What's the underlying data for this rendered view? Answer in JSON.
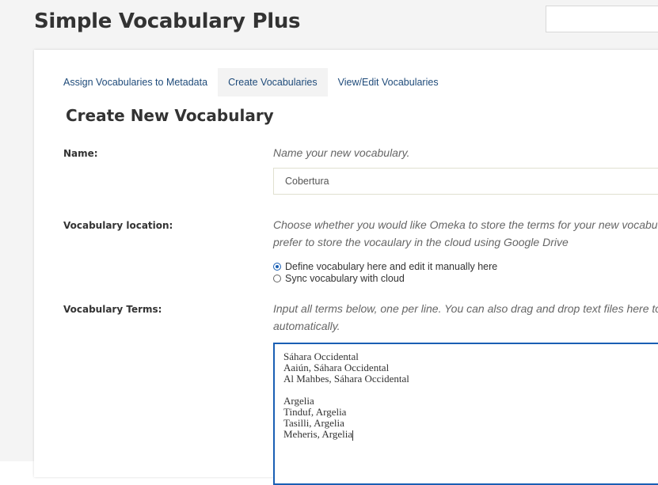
{
  "header": {
    "title": "Simple Vocabulary Plus",
    "search_placeholder": ""
  },
  "tabs": [
    {
      "label": "Assign Vocabularies to Metadata",
      "active": false
    },
    {
      "label": "Create Vocabularies",
      "active": true
    },
    {
      "label": "View/Edit Vocabularies",
      "active": false
    }
  ],
  "form": {
    "section_title": "Create New Vocabulary",
    "name": {
      "label": "Name:",
      "hint": "Name your new vocabulary.",
      "value": "Cobertura"
    },
    "location": {
      "label": "Vocabulary location:",
      "hint_line1": "Choose whether you would like Omeka to store the terms for your new vocabula",
      "hint_line2": "prefer to store the vocaulary in the cloud using Google Drive",
      "options": [
        {
          "label": "Define vocabulary here and edit it manually here",
          "checked": true
        },
        {
          "label": "Sync vocabulary with cloud",
          "checked": false
        }
      ]
    },
    "terms": {
      "label": "Vocabulary Terms:",
      "hint_line1": "Input all terms below, one per line. You can also drag and drop text files here to p",
      "hint_line2": "automatically.",
      "lines": [
        "Sáhara Occidental",
        "Aaiún, Sáhara Occidental",
        "Al Mahbes, Sáhara Occidental",
        "",
        "Argelia",
        "Tinduf, Argelia",
        "Tasilli, Argelia",
        "Meheris, Argelia"
      ]
    }
  },
  "colors": {
    "link": "#1f4b7a",
    "focus": "#1a5fb4",
    "active_tab_bg": "#f3f3f3"
  }
}
